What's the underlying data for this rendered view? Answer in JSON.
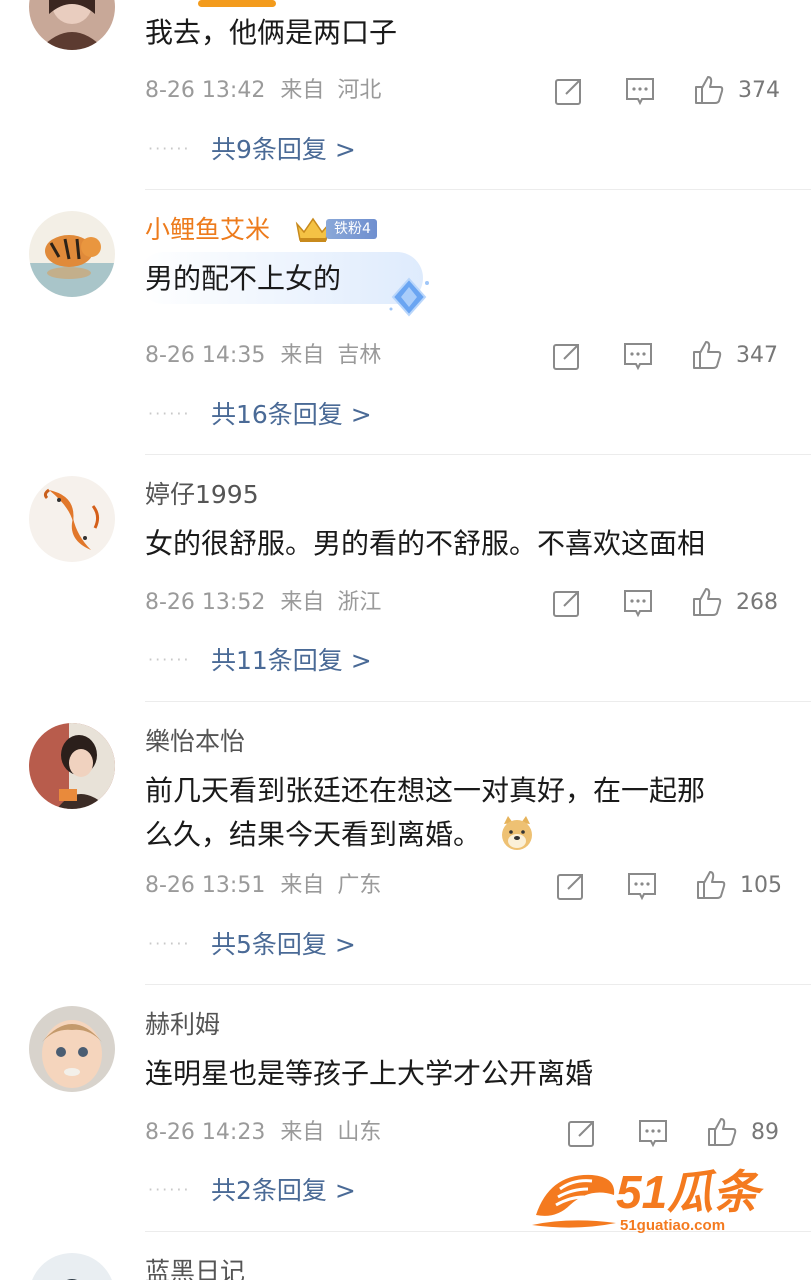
{
  "comments": [
    {
      "username": "",
      "text": "我去，他俩是两口子",
      "date": "8-26 13:42",
      "from_label": "来自",
      "location": "河北",
      "likes": "374",
      "replies": "共9条回复 >"
    },
    {
      "username": "小鲤鱼艾米",
      "badge": "铁粉4",
      "text": "男的配不上女的",
      "date": "8-26 14:35",
      "from_label": "来自",
      "location": "吉林",
      "likes": "347",
      "replies": "共16条回复 >"
    },
    {
      "username": "婷仔1995",
      "text": "女的很舒服。男的看的不舒服。不喜欢这面相",
      "date": "8-26 13:52",
      "from_label": "来自",
      "location": "浙江",
      "likes": "268",
      "replies": "共11条回复 >"
    },
    {
      "username": "樂怡本怡",
      "text_line1": "前几天看到张廷还在想这一对真好，在一起那",
      "text_line2": "么久，结果今天看到离婚。",
      "date": "8-26 13:51",
      "from_label": "来自",
      "location": "广东",
      "likes": "105",
      "replies": "共5条回复 >"
    },
    {
      "username": "赫利姆",
      "text": "连明星也是等孩子上大学才公开离婚",
      "date": "8-26 14:23",
      "from_label": "来自",
      "location": "山东",
      "likes": "89",
      "replies": "共2条回复 >"
    },
    {
      "username": "蓝黑日记"
    }
  ],
  "dots": "······",
  "watermark": {
    "brand": "51瓜条",
    "url": "51guatiao.com"
  },
  "colors": {
    "accent": "#f39b1c",
    "vip_name": "#ed7b1c",
    "link": "#4a6a96",
    "meta": "#9a9a9a"
  },
  "icons": [
    "share-icon",
    "reply-icon",
    "like-icon",
    "crown-icon",
    "diamond-icon",
    "doge-emoji-icon"
  ]
}
